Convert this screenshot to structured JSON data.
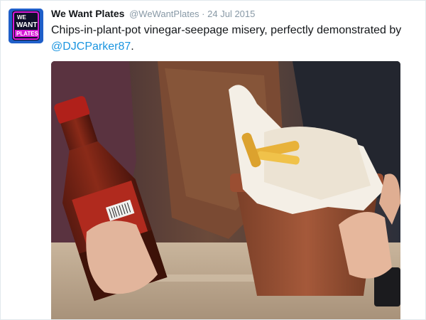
{
  "tweet": {
    "avatar": {
      "text_lines": [
        "WE",
        "WANT",
        "PLATES"
      ]
    },
    "display_name": "We Want Plates",
    "handle": "@WeWantPlates",
    "separator": "·",
    "timestamp": "24 Jul 2015",
    "text": "Chips-in-plant-pot vinegar-seepage misery, perfectly demonstrated by",
    "mention": "@DJCParker87",
    "text_end": ".",
    "media": {
      "subject": "photo"
    }
  },
  "colors": {
    "link": "#1b95e0",
    "meta_gray": "#8899a6",
    "text": "#14171a",
    "avatar_bg": "#1f5fc9",
    "avatar_accent": "#d81bd6"
  }
}
